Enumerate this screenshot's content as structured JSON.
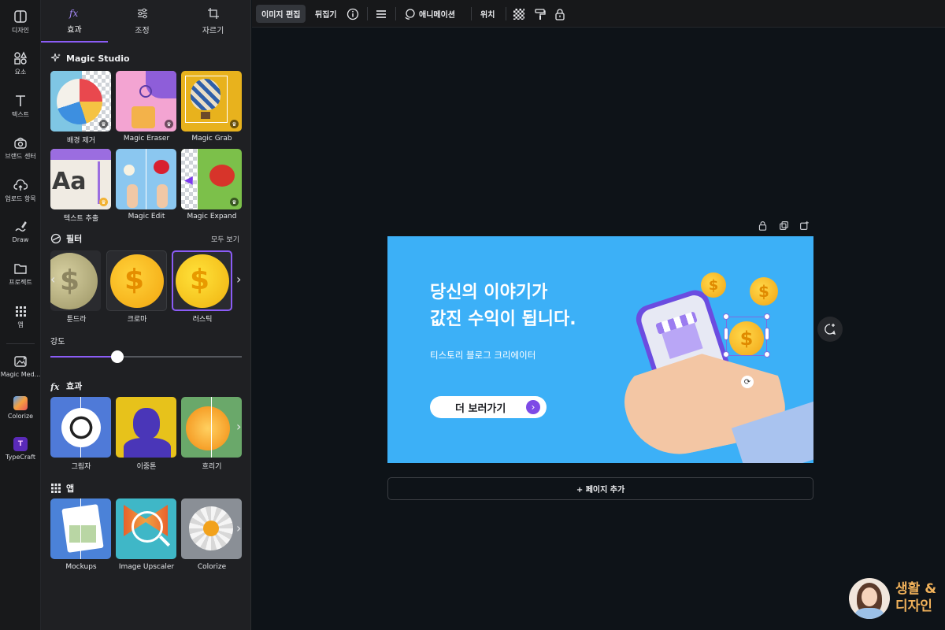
{
  "rail": {
    "items": [
      {
        "label": "디자인",
        "icon": "layout-icon"
      },
      {
        "label": "요소",
        "icon": "shapes-icon"
      },
      {
        "label": "텍스트",
        "icon": "text-icon"
      },
      {
        "label": "브랜드 센터",
        "icon": "brand-icon"
      },
      {
        "label": "업로드 항목",
        "icon": "upload-cloud-icon"
      },
      {
        "label": "Draw",
        "icon": "draw-icon"
      },
      {
        "label": "프로젝트",
        "icon": "folder-icon"
      },
      {
        "label": "앱",
        "icon": "apps-grid-icon"
      },
      {
        "label": "Magic Med...",
        "icon": "magic-media-icon"
      },
      {
        "label": "Colorize",
        "icon": "colorize-app-icon"
      },
      {
        "label": "TypeCraft",
        "icon": "typecraft-app-icon"
      }
    ]
  },
  "panel": {
    "tabs": [
      {
        "label": "효과",
        "icon": "fx-icon",
        "active": true
      },
      {
        "label": "조정",
        "icon": "sliders-icon",
        "active": false
      },
      {
        "label": "자르기",
        "icon": "crop-icon",
        "active": false
      }
    ],
    "magic_studio": {
      "title": "Magic Studio",
      "tools": [
        {
          "label": "배경 제거"
        },
        {
          "label": "Magic Eraser"
        },
        {
          "label": "Magic Grab"
        },
        {
          "label": "텍스트 추출"
        },
        {
          "label": "Magic Edit"
        },
        {
          "label": "Magic Expand"
        }
      ]
    },
    "filters": {
      "title": "필터",
      "see_all": "모두 보기",
      "items": [
        {
          "label": "툰드라"
        },
        {
          "label": "크로마"
        },
        {
          "label": "러스틱"
        }
      ],
      "strength_label": "강도",
      "strength_value": 0.35
    },
    "effects": {
      "title": "효과",
      "items": [
        {
          "label": "그림자"
        },
        {
          "label": "이중톤"
        },
        {
          "label": "흐리기"
        }
      ]
    },
    "apps": {
      "title": "앱",
      "items": [
        {
          "label": "Mockups"
        },
        {
          "label": "Image Upscaler"
        },
        {
          "label": "Colorize"
        }
      ]
    }
  },
  "toolbar": {
    "edit_image": "이미지 편집",
    "flip": "뒤집기",
    "animation": "애니메이션",
    "position": "위치"
  },
  "design": {
    "headline_1": "당신의 이야기가",
    "headline_2": "값진 수익이 됩니다.",
    "subtitle": "티스토리 블로그 크리에이터",
    "cta": "더 보러가기",
    "coin_symbol": "$"
  },
  "add_page": "+ 페이지 추가",
  "watermark": {
    "line1": "생활 &",
    "line2": "디자인"
  },
  "colors": {
    "accent": "#8b5cf6",
    "canvas_bg": "#0e1318",
    "design_bg": "#3cb0f7"
  }
}
